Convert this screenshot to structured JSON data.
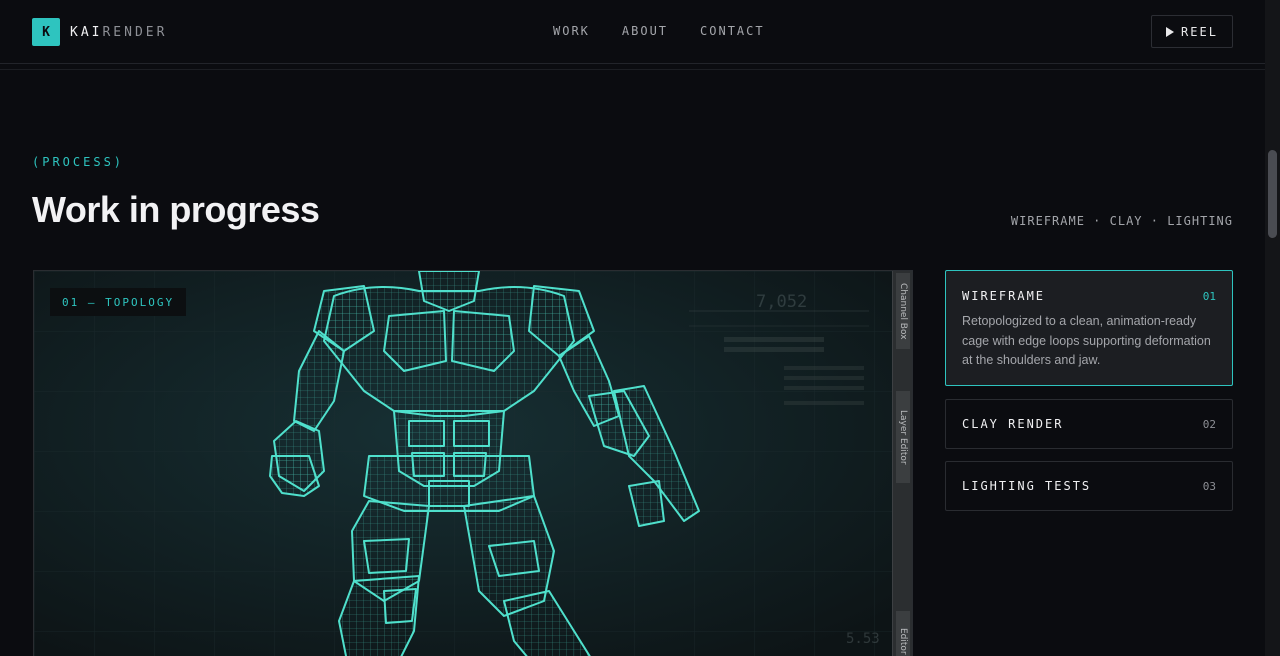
{
  "header": {
    "logo_mark": "K",
    "logo_primary": "KAI",
    "logo_secondary": "RENDER",
    "nav": [
      "WORK",
      "ABOUT",
      "CONTACT"
    ],
    "reel_label": "REEL"
  },
  "section": {
    "eyebrow": "(PROCESS)",
    "title": "Work in progress",
    "stages": "WIREFRAME · CLAY · LIGHTING"
  },
  "viewport": {
    "label": "01 — TOPOLOGY",
    "readout": "7,052",
    "readout_small": "5.53",
    "side_tabs": [
      "Channel Box",
      "Layer Editor",
      "Editor"
    ]
  },
  "cards": [
    {
      "title": "WIREFRAME",
      "num": "01",
      "desc": "Retopologized to a clean, animation-ready cage with edge loops supporting deformation at the shoulders and jaw."
    },
    {
      "title": "CLAY RENDER",
      "num": "02"
    },
    {
      "title": "LIGHTING TESTS",
      "num": "03"
    }
  ],
  "colors": {
    "accent": "#2ec4bf",
    "background": "#0b0c10",
    "wireframe": "#4fe0cc"
  }
}
